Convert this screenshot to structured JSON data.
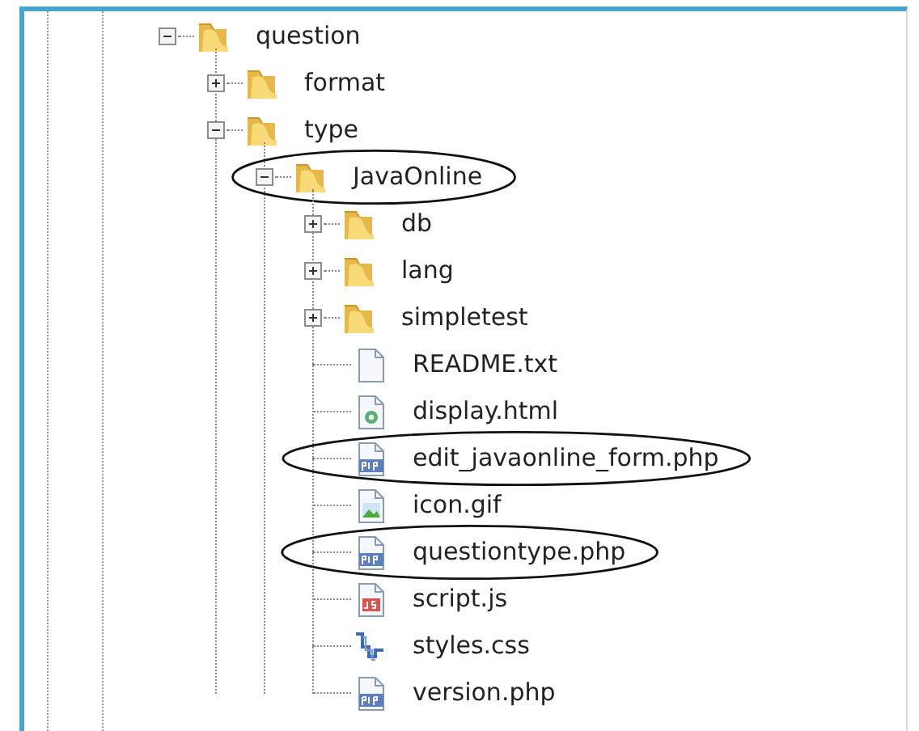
{
  "tree": [
    {
      "label": "question",
      "kind": "folder",
      "expanded": true,
      "circled": false,
      "children": [
        {
          "label": "format",
          "kind": "folder",
          "expanded": false,
          "circled": false
        },
        {
          "label": "type",
          "kind": "folder",
          "expanded": true,
          "circled": false,
          "children": [
            {
              "label": "JavaOnline",
              "kind": "folder",
              "expanded": true,
              "circled": true,
              "children": [
                {
                  "label": "db",
                  "kind": "folder",
                  "expanded": false,
                  "circled": false
                },
                {
                  "label": "lang",
                  "kind": "folder",
                  "expanded": false,
                  "circled": false
                },
                {
                  "label": "simpletest",
                  "kind": "folder",
                  "expanded": false,
                  "circled": false
                },
                {
                  "label": "README.txt",
                  "kind": "text",
                  "circled": false
                },
                {
                  "label": "display.html",
                  "kind": "html",
                  "circled": false
                },
                {
                  "label": "edit_javaonline_form.php",
                  "kind": "php",
                  "circled": true
                },
                {
                  "label": "icon.gif",
                  "kind": "image",
                  "circled": false
                },
                {
                  "label": "questiontype.php",
                  "kind": "php",
                  "circled": true
                },
                {
                  "label": "script.js",
                  "kind": "js",
                  "circled": false
                },
                {
                  "label": "styles.css",
                  "kind": "css",
                  "circled": false
                },
                {
                  "label": "version.php",
                  "kind": "php",
                  "circled": false
                }
              ]
            }
          ]
        }
      ]
    }
  ]
}
